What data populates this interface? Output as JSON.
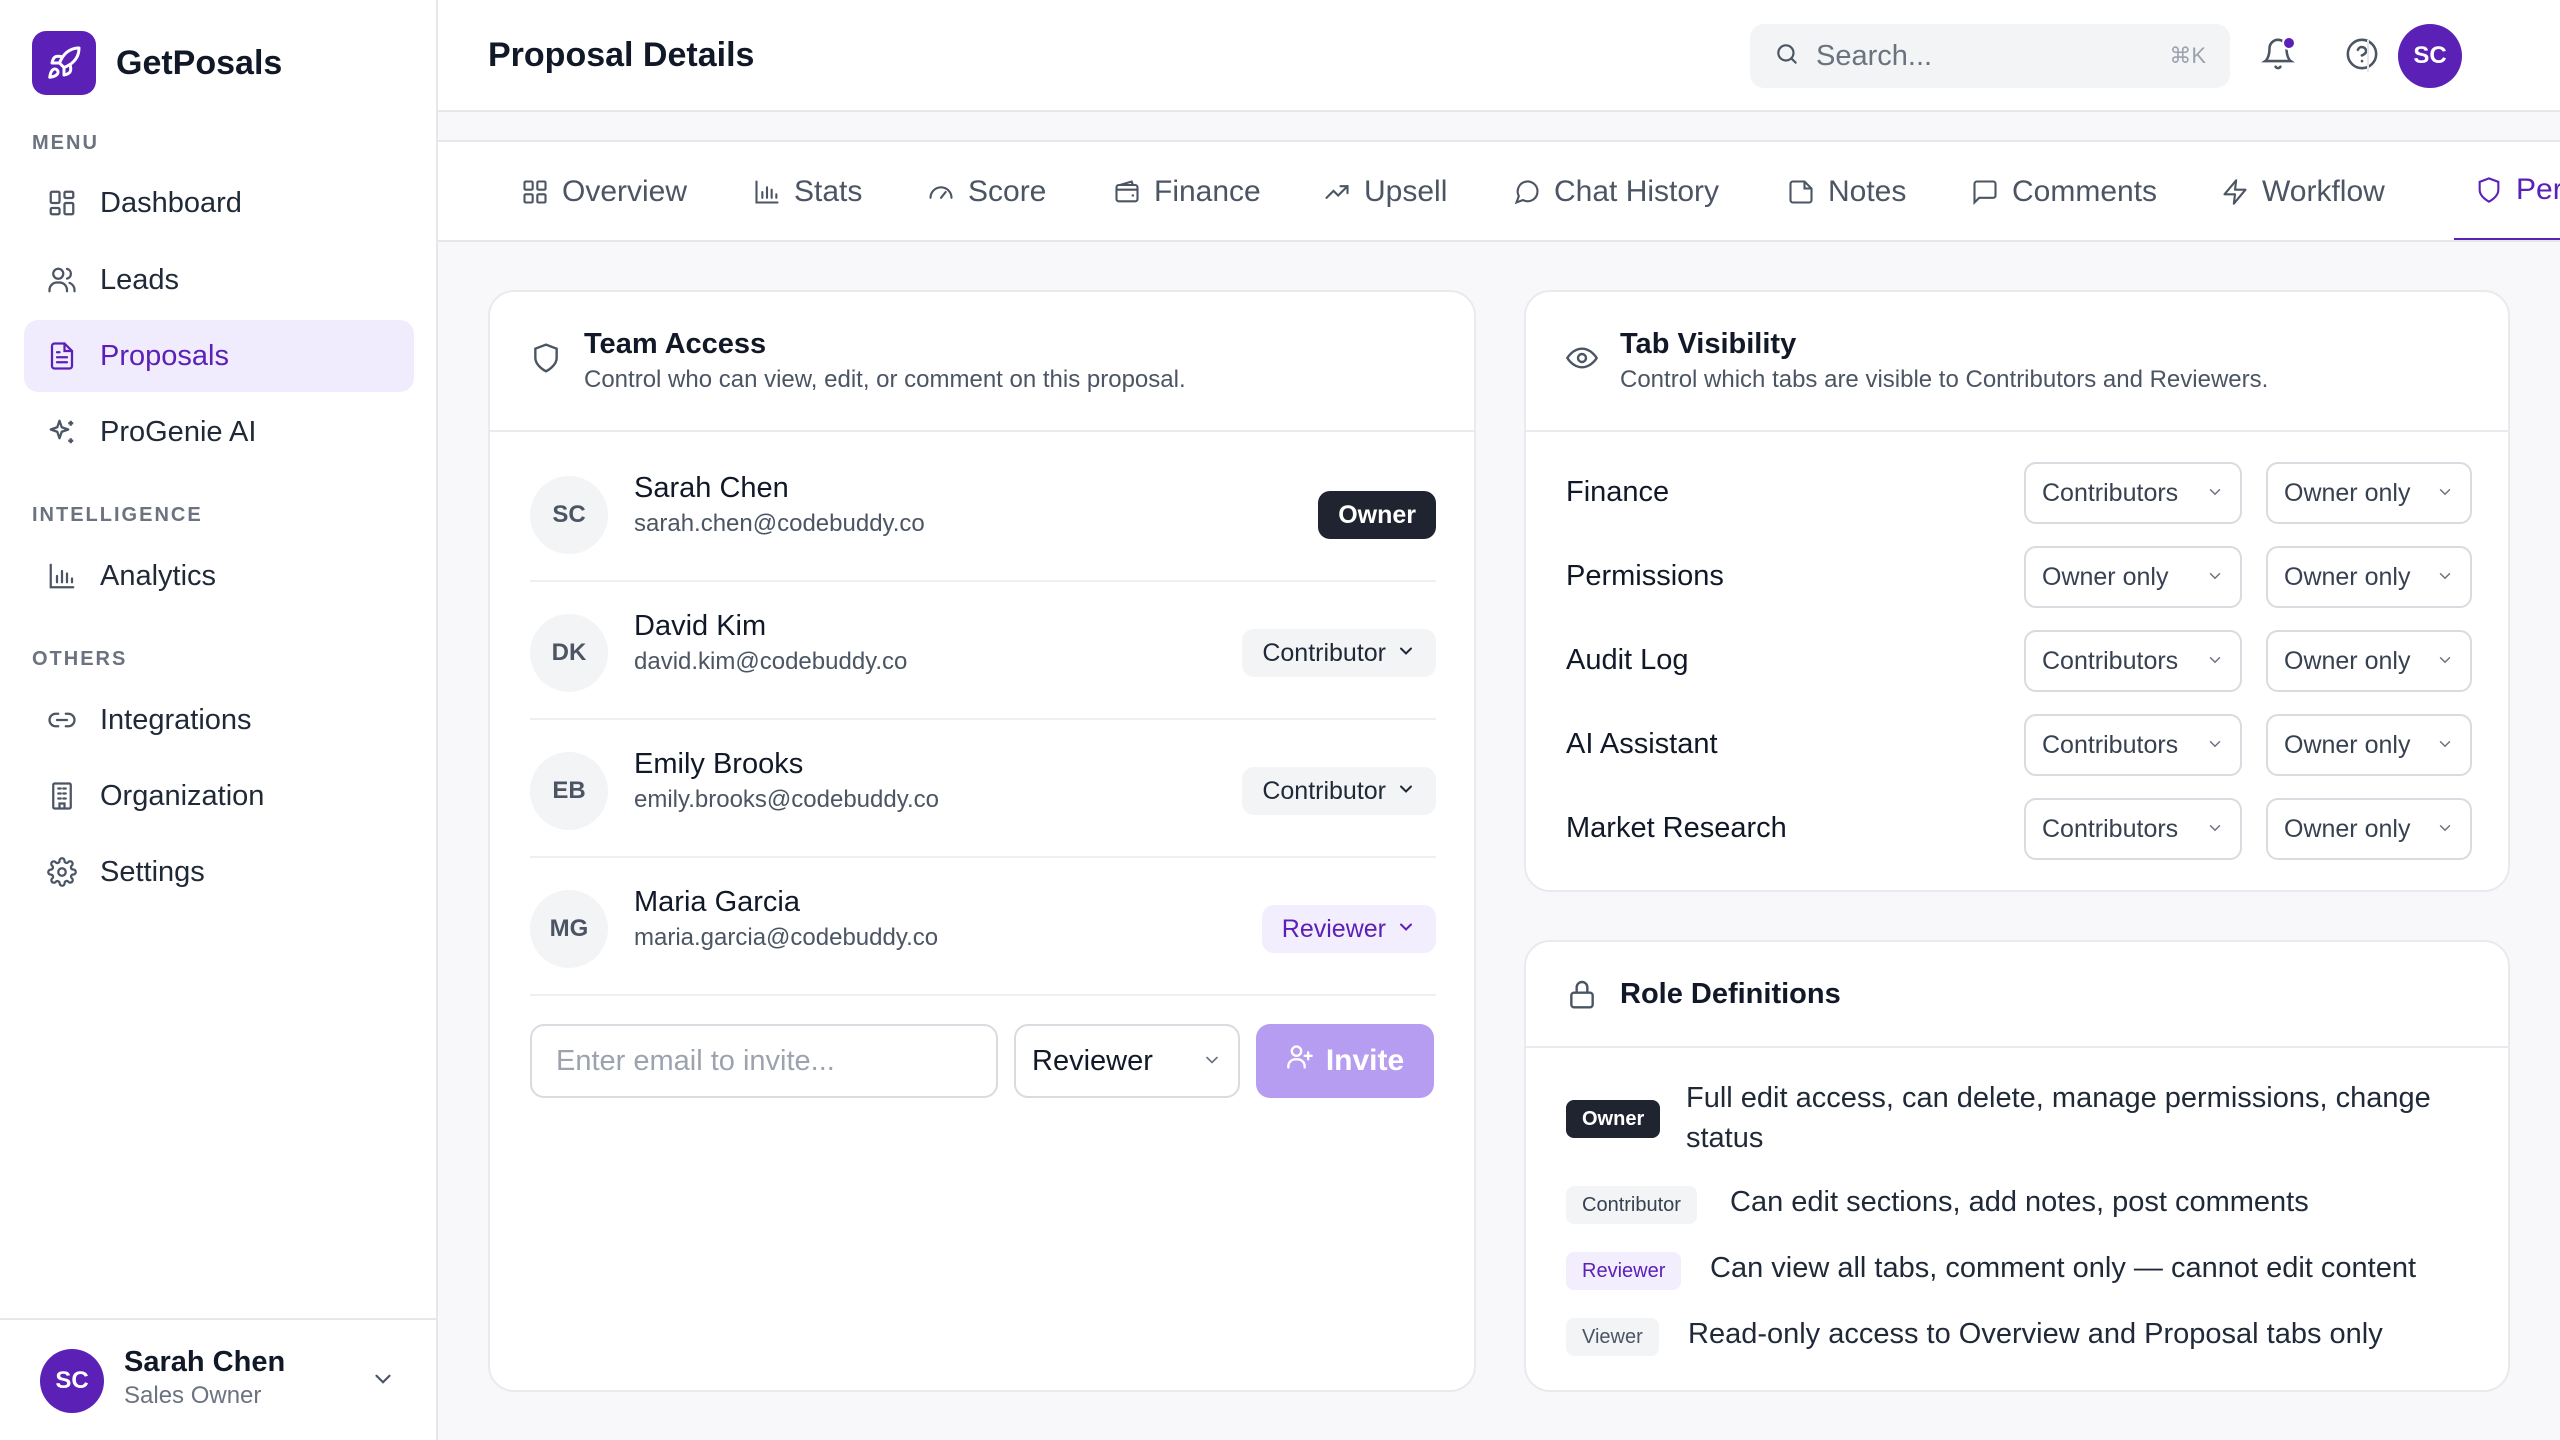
{
  "app": {
    "name": "GetPosals"
  },
  "sidebar": {
    "sections": [
      {
        "label": "MENU"
      },
      {
        "label": "INTELLIGENCE"
      },
      {
        "label": "OTHERS"
      }
    ],
    "items": [
      {
        "label": "Dashboard",
        "icon": "dashboard-icon"
      },
      {
        "label": "Leads",
        "icon": "users-icon"
      },
      {
        "label": "Proposals",
        "icon": "document-icon",
        "active": true
      },
      {
        "label": "ProGenie AI",
        "icon": "sparkles-icon"
      },
      {
        "label": "Analytics",
        "icon": "bar-chart-icon"
      },
      {
        "label": "Integrations",
        "icon": "link-icon"
      },
      {
        "label": "Organization",
        "icon": "building-icon"
      },
      {
        "label": "Settings",
        "icon": "gear-icon"
      }
    ],
    "user": {
      "initials": "SC",
      "name": "Sarah Chen",
      "role": "Sales Owner"
    }
  },
  "header": {
    "title": "Proposal Details",
    "search_placeholder": "Search...",
    "search_shortcut": "⌘K",
    "avatar_initials": "SC"
  },
  "tabs": [
    {
      "label": "Overview",
      "icon": "grid-icon"
    },
    {
      "label": "Stats",
      "icon": "bar-chart-icon"
    },
    {
      "label": "Score",
      "icon": "gauge-icon"
    },
    {
      "label": "Finance",
      "icon": "wallet-icon"
    },
    {
      "label": "Upsell",
      "icon": "trending-up-icon"
    },
    {
      "label": "Chat History",
      "icon": "chat-icon"
    },
    {
      "label": "Notes",
      "icon": "note-icon"
    },
    {
      "label": "Comments",
      "icon": "comment-icon"
    },
    {
      "label": "Workflow",
      "icon": "lightning-icon"
    },
    {
      "label": "Permissions",
      "icon": "shield-icon",
      "active": true
    }
  ],
  "team_access": {
    "title": "Team Access",
    "subtitle": "Control who can view, edit, or comment on this proposal.",
    "members": [
      {
        "initials": "SC",
        "name": "Sarah Chen",
        "email": "sarah.chen@codebuddy.co",
        "role": "Owner"
      },
      {
        "initials": "DK",
        "name": "David Kim",
        "email": "david.kim@codebuddy.co",
        "role": "Contributor"
      },
      {
        "initials": "EB",
        "name": "Emily Brooks",
        "email": "emily.brooks@codebuddy.co",
        "role": "Contributor"
      },
      {
        "initials": "MG",
        "name": "Maria Garcia",
        "email": "maria.garcia@codebuddy.co",
        "role": "Reviewer"
      }
    ],
    "invite": {
      "placeholder": "Enter email to invite...",
      "role": "Reviewer",
      "button": "Invite"
    }
  },
  "tab_visibility": {
    "title": "Tab Visibility",
    "subtitle": "Control which tabs are visible to Contributors and Reviewers.",
    "rows": [
      {
        "tab": "Finance",
        "contributors": "Contributors",
        "reviewers": "Owner only"
      },
      {
        "tab": "Permissions",
        "contributors": "Owner only",
        "reviewers": "Owner only"
      },
      {
        "tab": "Audit Log",
        "contributors": "Contributors",
        "reviewers": "Owner only"
      },
      {
        "tab": "AI Assistant",
        "contributors": "Contributors",
        "reviewers": "Owner only"
      },
      {
        "tab": "Market Research",
        "contributors": "Contributors",
        "reviewers": "Owner only"
      }
    ]
  },
  "role_definitions": {
    "title": "Role Definitions",
    "roles": [
      {
        "badge": "Owner",
        "text": "Full edit access, can delete, manage permissions, change status"
      },
      {
        "badge": "Contributor",
        "text": "Can edit sections, add notes, post comments"
      },
      {
        "badge": "Reviewer",
        "text": "Can view all tabs, comment only — cannot edit content"
      },
      {
        "badge": "Viewer",
        "text": "Read-only access to Overview and Proposal tabs only"
      }
    ]
  },
  "colors": {
    "accent": "#5b21b6",
    "accent_light": "#f1ecfd",
    "dark_badge": "#1f2430"
  }
}
